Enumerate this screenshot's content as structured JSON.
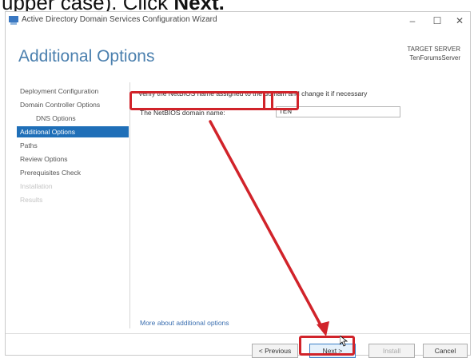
{
  "caption": {
    "prefix": "upper case). Click ",
    "bold": "Next."
  },
  "window": {
    "title": "Active Directory Domain Services Configuration Wizard",
    "controls": {
      "minimize": "–",
      "maximize": "☐",
      "close": "✕"
    }
  },
  "page": {
    "heading": "Additional Options",
    "target_label": "TARGET SERVER",
    "target_name": "TenForumsServer"
  },
  "nav": {
    "items": [
      {
        "label": "Deployment Configuration",
        "state": "normal"
      },
      {
        "label": "Domain Controller Options",
        "state": "normal"
      },
      {
        "label": "DNS Options",
        "state": "sub"
      },
      {
        "label": "Additional Options",
        "state": "active"
      },
      {
        "label": "Paths",
        "state": "normal"
      },
      {
        "label": "Review Options",
        "state": "normal"
      },
      {
        "label": "Prerequisites Check",
        "state": "normal"
      },
      {
        "label": "Installation",
        "state": "disabled"
      },
      {
        "label": "Results",
        "state": "disabled"
      }
    ]
  },
  "content": {
    "instruction": "Verify the NetBIOS name assigned to the domain and change it if necessary",
    "netbios_label": "The NetBIOS domain name:",
    "netbios_value": "TEN",
    "more_link": "More about additional options"
  },
  "buttons": {
    "previous": "< Previous",
    "next": "Next >",
    "install": "Install",
    "cancel": "Cancel"
  },
  "colors": {
    "accent": "#1f6fb8",
    "heading": "#4a7fae",
    "highlight": "#d1232a"
  }
}
